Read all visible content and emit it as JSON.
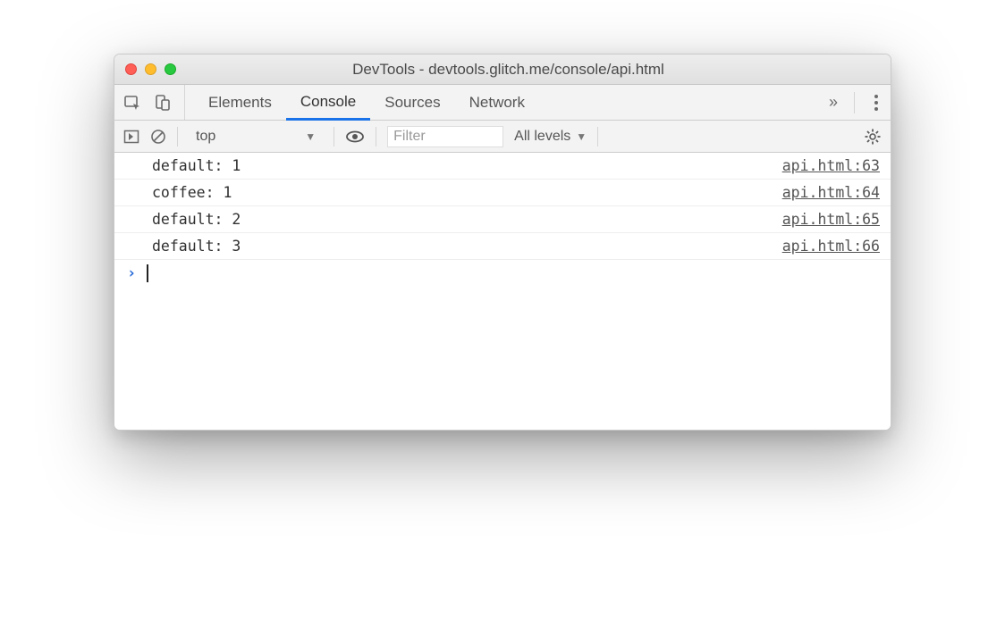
{
  "window": {
    "title": "DevTools - devtools.glitch.me/console/api.html"
  },
  "tabs": {
    "items": [
      "Elements",
      "Console",
      "Sources",
      "Network"
    ],
    "active": "Console",
    "more_glyph": "»"
  },
  "console_toolbar": {
    "context": "top",
    "filter_placeholder": "Filter",
    "levels_label": "All levels"
  },
  "console_rows": [
    {
      "message": "default: 1",
      "source": "api.html:63"
    },
    {
      "message": "coffee: 1",
      "source": "api.html:64"
    },
    {
      "message": "default: 2",
      "source": "api.html:65"
    },
    {
      "message": "default: 3",
      "source": "api.html:66"
    }
  ],
  "prompt_glyph": "›"
}
